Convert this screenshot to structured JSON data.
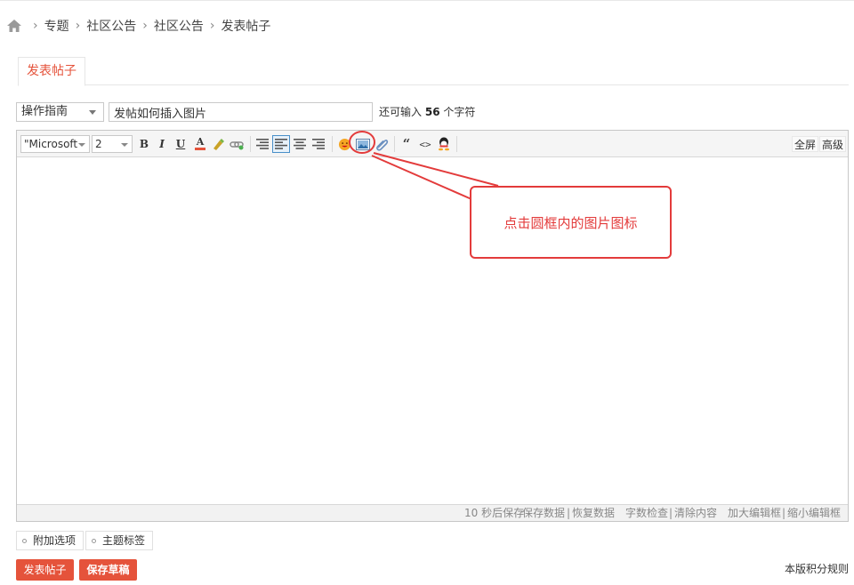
{
  "breadcrumb": {
    "home_icon": "home-icon",
    "items": [
      "专题",
      "社区公告",
      "社区公告",
      "发表帖子"
    ]
  },
  "tabs": {
    "active": "发表帖子"
  },
  "post": {
    "type_selected": "操作指南",
    "title_value": "发帖如何插入图片",
    "remain_prefix": "还可输入",
    "remain_count": "56",
    "remain_suffix": "个字符"
  },
  "toolbar": {
    "font_value": "\"Microsoft",
    "size_value": "2",
    "bold": "B",
    "italic": "I",
    "underline": "U",
    "font_color": "A",
    "quote": "“",
    "code": "<>",
    "fullscreen": "全屏",
    "advanced": "高级"
  },
  "statusbar": {
    "autosave": "10 秒后保存",
    "save_data": "保存数据",
    "restore_data": "恢复数据",
    "word_check": "字数检查",
    "clear_content": "清除内容",
    "enlarge": "加大编辑框",
    "shrink": "缩小编辑框",
    "sep": "|"
  },
  "annotation": {
    "callout_text": "点击圆框内的图片图标",
    "color": "#e33b3b"
  },
  "options": {
    "extra": "附加选项",
    "tags": "主题标签"
  },
  "actions": {
    "submit": "发表帖子",
    "save_draft": "保存草稿",
    "rules": "本版积分规则"
  },
  "colors": {
    "accent": "#e5533b"
  }
}
